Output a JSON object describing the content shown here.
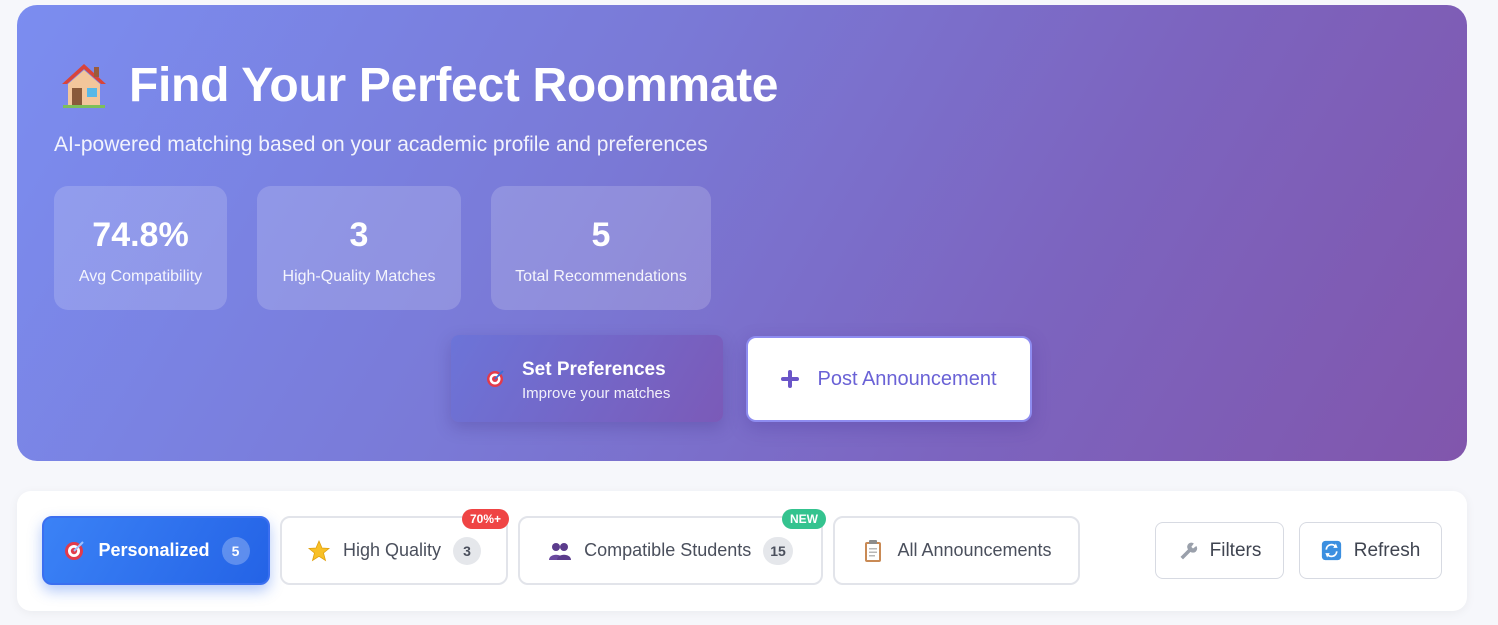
{
  "hero": {
    "title": "Find Your Perfect Roommate",
    "title_icon": "house-icon",
    "subtitle": "AI-powered matching based on your academic profile and preferences",
    "stats": [
      {
        "value": "74.8%",
        "label": "Avg Compatibility"
      },
      {
        "value": "3",
        "label": "High-Quality Matches"
      },
      {
        "value": "5",
        "label": "Total Recommendations"
      }
    ],
    "preferences_button": {
      "title": "Set Preferences",
      "subtitle": "Improve your matches",
      "icon": "target-icon"
    },
    "post_button": {
      "label": "Post Announcement",
      "icon": "plus-icon"
    }
  },
  "tabs": [
    {
      "label": "Personalized",
      "count": "5",
      "icon": "target-icon",
      "active": true
    },
    {
      "label": "High Quality",
      "count": "3",
      "icon": "star-icon",
      "tag": "70%+"
    },
    {
      "label": "Compatible Students",
      "count": "15",
      "icon": "people-icon",
      "tag": "NEW"
    },
    {
      "label": "All Announcements",
      "icon": "clipboard-icon"
    }
  ],
  "actions": {
    "filters": {
      "label": "Filters",
      "icon": "wrench-icon"
    },
    "refresh": {
      "label": "Refresh",
      "icon": "refresh-icon"
    }
  },
  "colors": {
    "hero_gradient_start": "#7b8df0",
    "hero_gradient_end": "#8156ac",
    "active_tab": "#2f6fef",
    "tag_red": "#ef4444",
    "tag_green": "#34c38f",
    "accent_text": "#6a62d6"
  }
}
